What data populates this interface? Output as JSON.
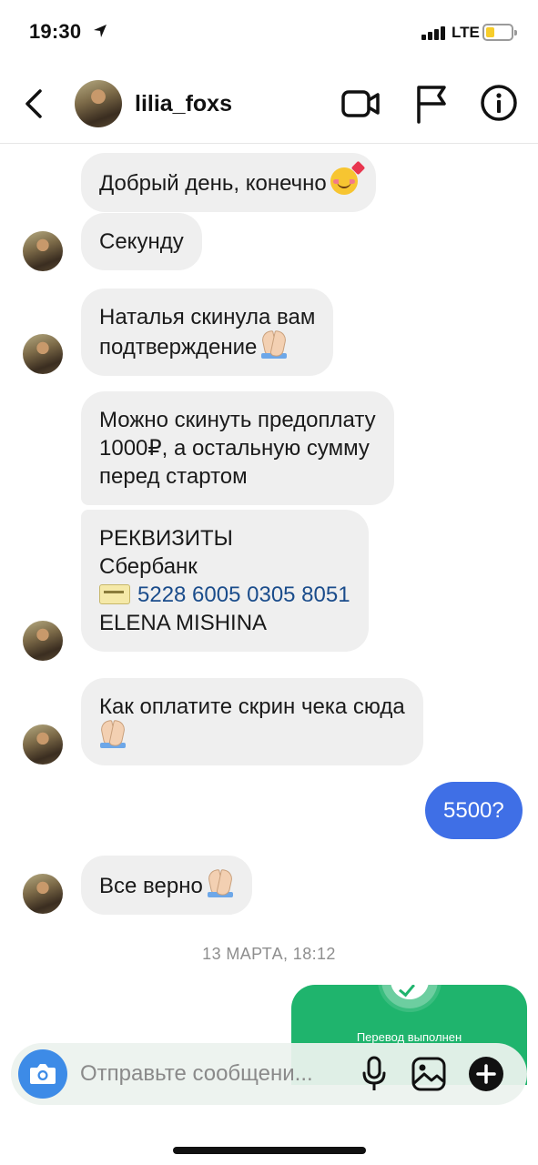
{
  "status_bar": {
    "time": "19:30",
    "network": "LTE",
    "battery_color": "#f7cd2a"
  },
  "header": {
    "username": "lilia_foxs"
  },
  "messages": {
    "m1": {
      "line1": "Добрый день, конечно"
    },
    "m2": {
      "line1": "Секунду"
    },
    "m3": {
      "line1": "Наталья скинула вам",
      "line2": "подтверждение"
    },
    "m4": {
      "line1": "Можно скинуть предоплату",
      "line2": "1000₽, а остальную сумму",
      "line3": "перед стартом"
    },
    "m5": {
      "line1": "РЕКВИЗИТЫ",
      "line2": "Сбербанк",
      "card_number": "5228 6005 0305 8051",
      "line4": "ELENA MISHINA"
    },
    "m6": {
      "line1": "Как оплатите скрин чека сюда"
    },
    "m7_out": {
      "text": "5500?"
    },
    "m8": {
      "line1": "Все верно"
    }
  },
  "date_separator": "13 МАРТА, 18:12",
  "receipt": {
    "caption": "Перевод выполнен",
    "color": "#1fb46d"
  },
  "composer": {
    "placeholder": "Отправьте сообщени..."
  },
  "colors": {
    "outgoing_bubble": "#3f6fe6",
    "incoming_bubble": "#efefef",
    "camera_button": "#3d8be7"
  },
  "icons": [
    "back-chevron-icon",
    "video-camera-icon",
    "flag-icon",
    "info-icon",
    "camera-icon",
    "microphone-icon",
    "gallery-icon",
    "plus-icon",
    "praying-hands-emoji",
    "smiling-face-with-hearts-emoji",
    "credit-card-emoji"
  ]
}
